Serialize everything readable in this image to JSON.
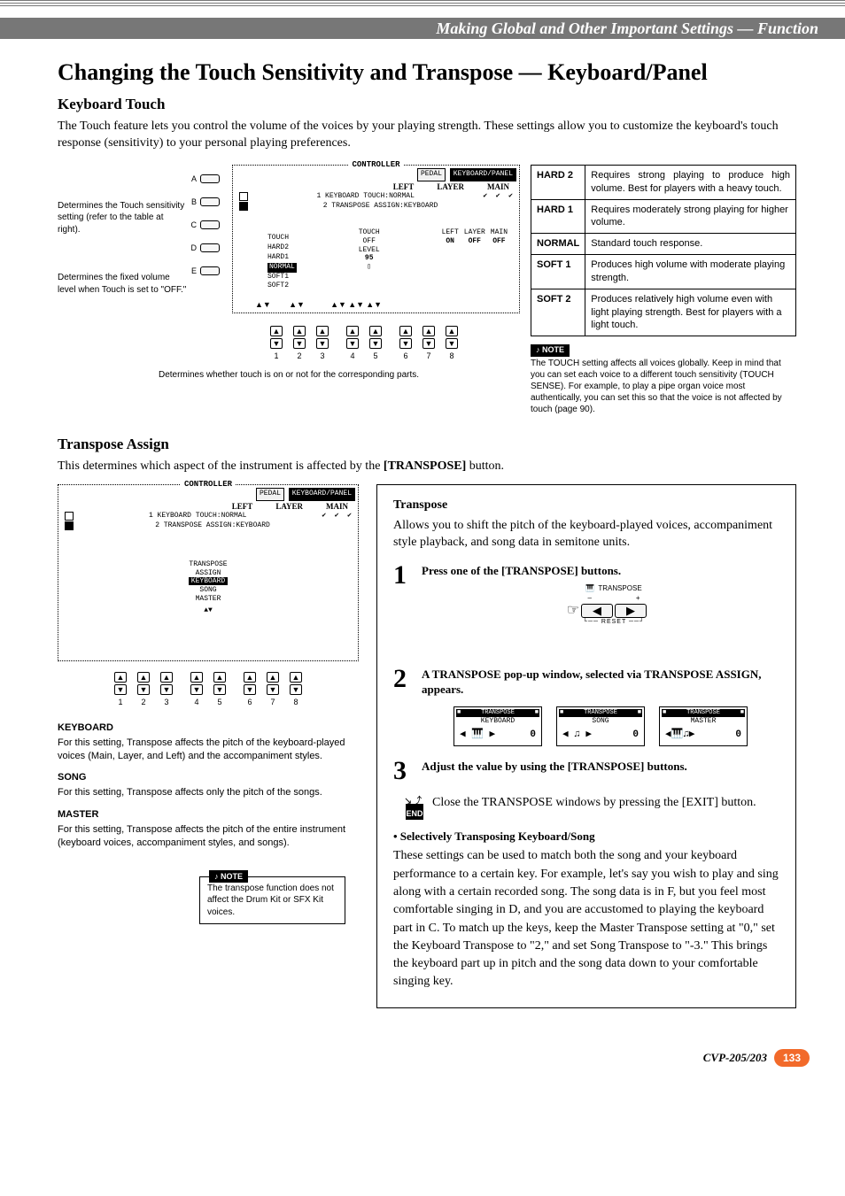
{
  "breadcrumb": "Making Global and Other Important Settings — Function",
  "h1": "Changing the Touch Sensitivity and Transpose — Keyboard/Panel",
  "keyboard_touch": {
    "heading": "Keyboard Touch",
    "intro": "The Touch feature lets you control the volume of the voices by your playing strength. These settings allow you to customize the keyboard's touch response (sensitivity) to your personal playing preferences.",
    "annot_left_1": "Determines the Touch sensitivity setting (refer to the table at right).",
    "annot_left_2": "Determines the fixed volume level when Touch is set to \"OFF.\"",
    "caption_below": "Determines whether touch is on or not for the corresponding parts.",
    "lcd": {
      "title": "CONTROLLER",
      "tab_active": "KEYBOARD/PANEL",
      "cols": [
        "LEFT",
        "LAYER",
        "MAIN"
      ],
      "row1": "1 KEYBOARD TOUCH:NORMAL",
      "row2": "2 TRANSPOSE ASSIGN:KEYBOARD",
      "touch_label": "TOUCH\nOFF\nLEVEL\n95",
      "touch_options": [
        "TOUCH",
        "HARD2",
        "HARD1",
        "NORMAL",
        "SOFT1",
        "SOFT2"
      ],
      "bottom_labels": [
        "LEFT",
        "LAYER",
        "MAIN"
      ],
      "bottom_vals": [
        "ON",
        "OFF",
        "OFF"
      ]
    }
  },
  "touch_table": [
    {
      "k": "HARD 2",
      "d": "Requires strong playing to produce high volume. Best for players with a heavy touch."
    },
    {
      "k": "HARD 1",
      "d": "Requires moderately strong playing for higher volume."
    },
    {
      "k": "NORMAL",
      "d": "Standard touch response."
    },
    {
      "k": "SOFT 1",
      "d": "Produces high volume with moderate playing strength."
    },
    {
      "k": "SOFT 2",
      "d": "Produces relatively high volume even with light playing strength. Best for players with a light touch."
    }
  ],
  "note1": {
    "tag": "NOTE",
    "text": "The TOUCH setting affects all voices globally. Keep in mind that you can set each voice to a different touch sensitivity (TOUCH SENSE). For example, to play a pipe organ voice most authentically, you can set this so that the voice is not affected by touch (page 90)."
  },
  "transpose_assign": {
    "heading": "Transpose Assign",
    "intro": "This determines which aspect of the instrument is affected by the [TRANSPOSE] button.",
    "options": [
      "TRANSPOSE",
      "ASSIGN",
      "KEYBOARD",
      "SONG",
      "MASTER"
    ],
    "selected": "KEYBOARD",
    "keyboard": {
      "label": "KEYBOARD",
      "text": "For this setting, Transpose affects the pitch of the keyboard-played voices (Main, Layer, and Left) and the accompaniment styles."
    },
    "song": {
      "label": "SONG",
      "text": "For this setting, Transpose affects only the pitch of the songs."
    },
    "master": {
      "label": "MASTER",
      "text": "For this setting, Transpose affects the pitch of the entire instrument (keyboard voices, accompaniment styles, and songs)."
    },
    "note": {
      "tag": "NOTE",
      "text": "The transpose function does not affect the Drum Kit or SFX Kit voices."
    }
  },
  "transpose_box": {
    "heading": "Transpose",
    "lead": "Allows you to shift the pitch of the keyboard-played voices, accompaniment style playback, and song data in semitone units.",
    "step1": "Press one of the [TRANSPOSE] buttons.",
    "trans_label": "TRANSPOSE",
    "reset": "RESET",
    "step2": "A TRANSPOSE pop-up window, selected via TRANSPOSE ASSIGN, appears.",
    "popups": [
      {
        "t1": "TRANSPOSE",
        "t2": "KEYBOARD",
        "v": "0"
      },
      {
        "t1": "TRANSPOSE",
        "t2": "SONG",
        "v": "0"
      },
      {
        "t1": "TRANSPOSE",
        "t2": "MASTER",
        "v": "0"
      }
    ],
    "step3": "Adjust the value by using the [TRANSPOSE] buttons.",
    "end_label": "END",
    "end_text": "Close the TRANSPOSE windows by pressing the [EXIT] button.",
    "sel_title": "• Selectively Transposing Keyboard/Song",
    "sel_body": "These settings can be used to match both the song and your keyboard performance to a certain key. For example, let's say you wish to play and sing along with a certain recorded song. The song data is in F, but you feel most comfortable singing in D, and you are accustomed to playing the keyboard part in C. To match up the keys, keep the Master Transpose setting at \"0,\" set the Keyboard Transpose to \"2,\" and set Song Transpose to \"-3.\" This brings the keyboard part up in pitch and the song data down to your comfortable singing key."
  },
  "footer": {
    "model": "CVP-205/203",
    "page": "133"
  }
}
